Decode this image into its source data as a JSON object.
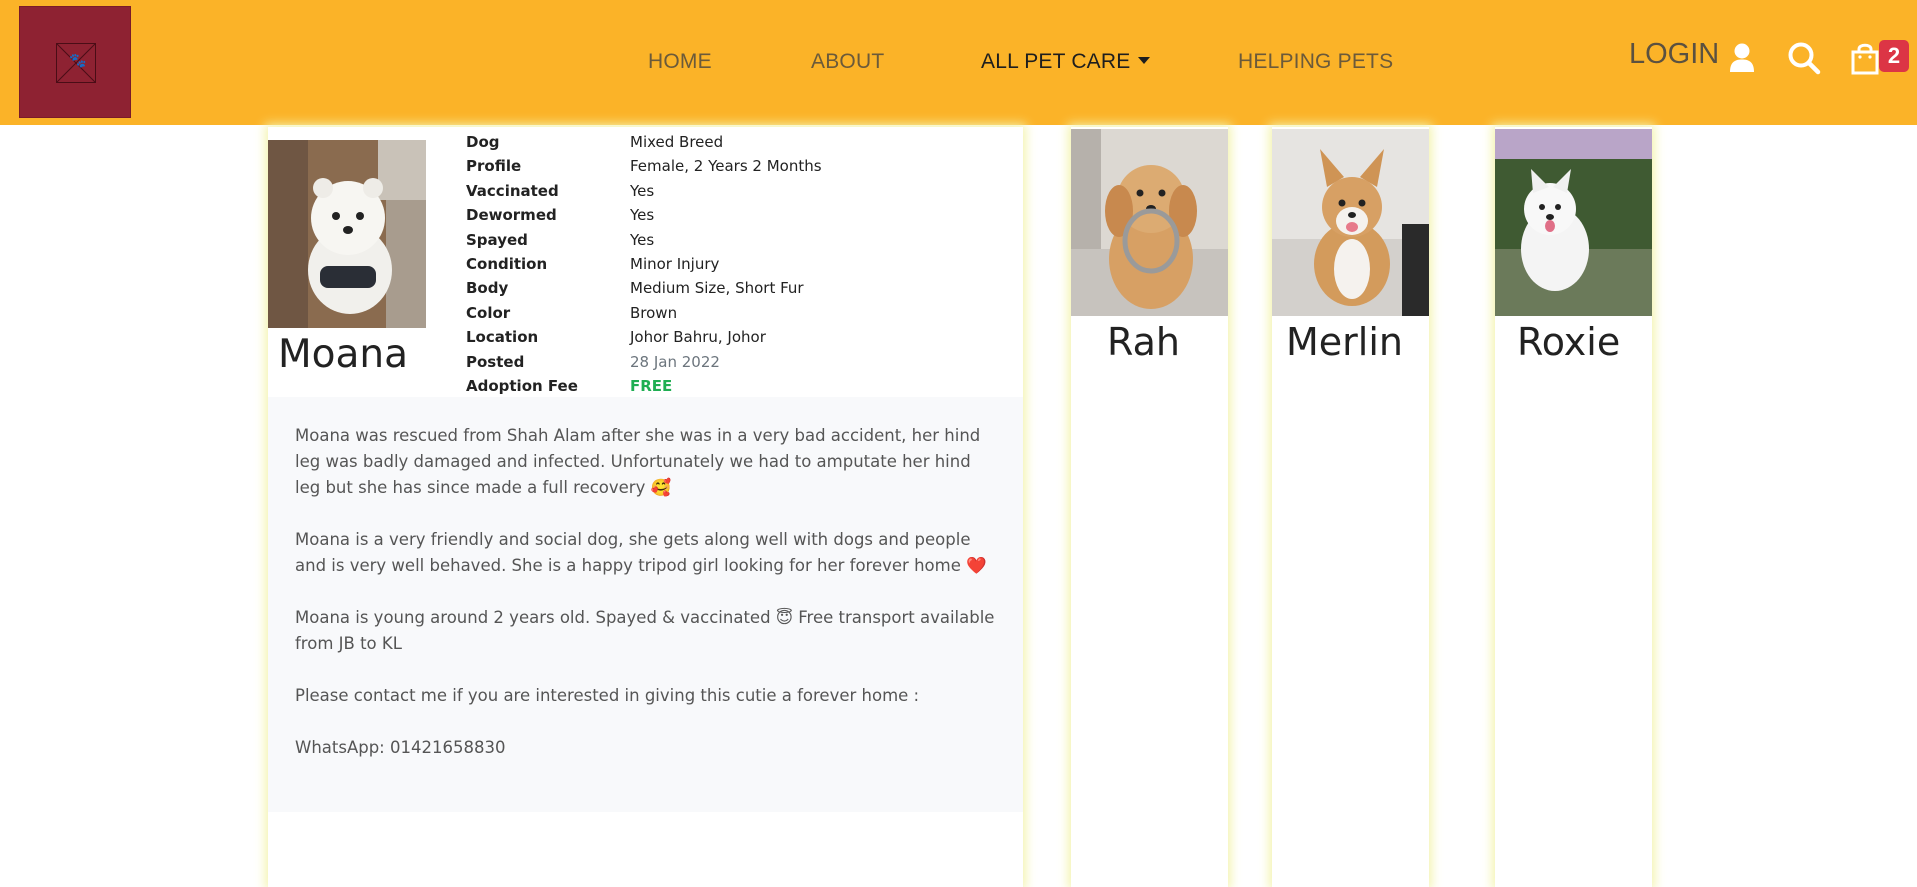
{
  "nav": {
    "home": "HOME",
    "about": "ABOUT",
    "all_pet_care": "ALL PET CARE",
    "helping_pets": "HELPING PETS",
    "login": "LOGIN",
    "cart_count": "2"
  },
  "pet": {
    "name": "Moana",
    "details": [
      {
        "label": "Dog",
        "value": "Mixed Breed"
      },
      {
        "label": "Profile",
        "value": "Female, 2 Years 2 Months"
      },
      {
        "label": "Vaccinated",
        "value": "Yes"
      },
      {
        "label": "Dewormed",
        "value": "Yes"
      },
      {
        "label": "Spayed",
        "value": "Yes"
      },
      {
        "label": "Condition",
        "value": "Minor Injury"
      },
      {
        "label": "Body",
        "value": "Medium Size, Short Fur"
      },
      {
        "label": "Color",
        "value": "Brown"
      },
      {
        "label": "Location",
        "value": "Johor Bahru, Johor"
      },
      {
        "label": "Posted",
        "value": "28 Jan 2022"
      },
      {
        "label": "Adoption Fee",
        "value": "FREE"
      }
    ],
    "description": [
      "Moana was rescued from Shah Alam after she was in a very bad accident, her hind leg was badly damaged and infected. Unfortunately we had to amputate her hind leg but she has since made a full recovery 🥰",
      "Moana is a very friendly and social dog, she gets along well with dogs and people and is very well behaved. She is a happy tripod girl looking for her forever home ❤️",
      "Moana is young around 2 years old. Spayed & vaccinated 😇 Free transport available from JB to KL",
      "Please contact me if you are interested in giving this cutie a forever home :",
      "WhatsApp: 01421658830"
    ]
  },
  "other_pets": [
    {
      "name": "Rah"
    },
    {
      "name": "Merlin"
    },
    {
      "name": "Roxie"
    }
  ],
  "colors": {
    "navbar": "#fbb328",
    "logo": "#8e2232",
    "badge": "#dc3545",
    "free": "#1fae52"
  }
}
